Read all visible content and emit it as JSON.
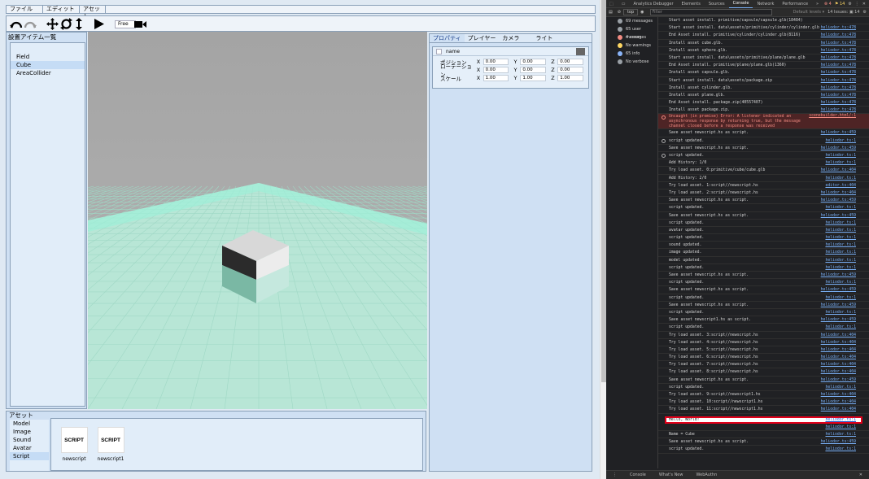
{
  "app": {
    "menu": [
      "ファイル",
      "エディット",
      "アセット"
    ],
    "toolbar": {
      "free_label": "Free"
    },
    "left_panel": {
      "title": "設置アイテム一覧",
      "items": [
        "Field",
        "Cube",
        "AreaCollider"
      ],
      "selected": 1
    },
    "right_panel": {
      "tabs": [
        "プロパティ",
        "プレイヤー",
        "カメラ",
        "ライト"
      ],
      "name_label": "name",
      "rows": [
        {
          "label": "ポジション",
          "x": "0.00",
          "y": "0.00",
          "z": "0.00"
        },
        {
          "label": "ローテーション",
          "x": "0.00",
          "y": "0.00",
          "z": "0.00"
        },
        {
          "label": "スケール",
          "x": "1.00",
          "y": "1.00",
          "z": "1.00"
        }
      ]
    },
    "bottom_panel": {
      "title": "アセット",
      "categories": [
        "Model",
        "Image",
        "Sound",
        "Avatar",
        "Script"
      ],
      "selected": 4,
      "assets": [
        {
          "thumb": "SCRIPT",
          "name": "newscript"
        },
        {
          "thumb": "SCRIPT",
          "name": "newscript1"
        }
      ]
    }
  },
  "devtools": {
    "tabs": [
      "Analytics Debugger",
      "Elements",
      "Sources",
      "Console",
      "Network",
      "Performance",
      "»"
    ],
    "active_tab": "Console",
    "issues_errors": "4",
    "issues_warnings": "14",
    "filter_context": "top",
    "filter_placeholder": "Filter",
    "levels": "Default levels ▾",
    "issues_count": "14 Issues: ▣ 14",
    "sidebar": [
      {
        "label": "69 messages",
        "color": "#9aa0a6"
      },
      {
        "label": "65 user messages",
        "color": "#9aa0a6"
      },
      {
        "label": "4 errors",
        "color": "#f28b82"
      },
      {
        "label": "No warnings",
        "color": "#fdd663"
      },
      {
        "label": "65 info",
        "color": "#8ab4f8"
      },
      {
        "label": "No verbose",
        "color": "#9aa0a6"
      }
    ],
    "logs": [
      {
        "text": "Start asset install. primitive/capsule/capsule.glb(18484)",
        "src": ""
      },
      {
        "text": "Start asset install. data\\assets/primitive/cylinder/cylinder.glb",
        "src": "heliodor.ts:478"
      },
      {
        "text": "End Asset install. primitive/cylinder/cylinder.glb(8116)",
        "src": "heliodor.ts:478"
      },
      {
        "text": "Install asset cube.glb.",
        "src": "heliodor.ts:478"
      },
      {
        "text": "Install asset sphere.glb.",
        "src": "heliodor.ts:478"
      },
      {
        "text": "Start asset install. data\\assets/primitive/plane/plane.glb",
        "src": "heliodor.ts:478"
      },
      {
        "text": "End Asset install. primitive/plane/plane.glb(1360)",
        "src": "heliodor.ts:478"
      },
      {
        "text": "Install asset capsule.glb.",
        "src": "heliodor.ts:478"
      },
      {
        "text": "Start asset install. data\\assets/package.zip",
        "src": "heliodor.ts:478"
      },
      {
        "text": "Install asset cylinder.glb.",
        "src": "heliodor.ts:478"
      },
      {
        "text": "Install asset plane.glb.",
        "src": "heliodor.ts:478"
      },
      {
        "text": "End Asset install. package.zip(40557407)",
        "src": "heliodor.ts:478"
      },
      {
        "text": "Install asset package.zip.",
        "src": "heliodor.ts:478"
      },
      {
        "text": "Uncaught (in promise) Error: A listener indicated an asynchronous response by returning true, but the message channel closed before a response was received",
        "src": "scenebuilder.html/:1",
        "err": true
      },
      {
        "text": "Save asset newscript.hs as script.",
        "src": "heliodor.ts:459"
      },
      {
        "text": "script updated.",
        "src": "heliodor.ts:1",
        "icon": true
      },
      {
        "text": "Save asset newscript.hs as script.",
        "src": "heliodor.ts:459"
      },
      {
        "text": "script updated.",
        "src": "heliodor.ts:1",
        "icon": true
      },
      {
        "text": "Add History: 1/0",
        "src": "heliodor.ts:1"
      },
      {
        "text": "Try load asset. 0:primitive/cube/cube.glb",
        "src": "heliodor.ts:404"
      },
      {
        "text": "Add History: 2/0",
        "src": "heliodor.ts:1"
      },
      {
        "text": "Try load asset. 1:script//newscript.hs",
        "src": "editor.ts:404"
      },
      {
        "text": "Try load asset. 2:script//newscript.hs",
        "src": "heliodor.ts:404"
      },
      {
        "text": "Save asset newscript.hs as script.",
        "src": "heliodor.ts:459"
      },
      {
        "text": "script updated.",
        "src": "heliodor.ts:1"
      },
      {
        "text": "Save asset newscript.hs as script.",
        "src": "heliodor.ts:459"
      },
      {
        "text": "script updated.",
        "src": "heliodor.ts:1"
      },
      {
        "text": "avatar updated.",
        "src": "heliodor.ts:1"
      },
      {
        "text": "script updated.",
        "src": "heliodor.ts:1"
      },
      {
        "text": "sound updated.",
        "src": "heliodor.ts:1"
      },
      {
        "text": "image updated.",
        "src": "heliodor.ts:1"
      },
      {
        "text": "model updated.",
        "src": "heliodor.ts:1"
      },
      {
        "text": "script updated.",
        "src": "heliodor.ts:1"
      },
      {
        "text": "Save asset newscript.hs as script.",
        "src": "heliodor.ts:459"
      },
      {
        "text": "script updated.",
        "src": "heliodor.ts:1"
      },
      {
        "text": "Save asset newscript.hs as script.",
        "src": "heliodor.ts:459"
      },
      {
        "text": "script updated.",
        "src": "heliodor.ts:1"
      },
      {
        "text": "Save asset newscript.hs as script.",
        "src": "heliodor.ts:459"
      },
      {
        "text": "script updated.",
        "src": "heliodor.ts:1"
      },
      {
        "text": "Save asset newscript1.hs as script.",
        "src": "heliodor.ts:459"
      },
      {
        "text": "script updated.",
        "src": "heliodor.ts:1"
      },
      {
        "text": "Try load asset. 3:script//newscript.hs",
        "src": "heliodor.ts:404"
      },
      {
        "text": "Try load asset. 4:script//newscript.hs",
        "src": "heliodor.ts:404"
      },
      {
        "text": "Try load asset. 5:script//newscript.hs",
        "src": "heliodor.ts:404"
      },
      {
        "text": "Try load asset. 6:script//newscript.hs",
        "src": "heliodor.ts:404"
      },
      {
        "text": "Try load asset. 7:script//newscript.hs",
        "src": "heliodor.ts:404"
      },
      {
        "text": "Try load asset. 8:script//newscript.hs",
        "src": "heliodor.ts:404"
      },
      {
        "text": "Save asset newscript.hs as script.",
        "src": "heliodor.ts:459"
      },
      {
        "text": "script updated.",
        "src": "heliodor.ts:1"
      },
      {
        "text": "Try load asset. 9:script//newscript1.hs",
        "src": "heliodor.ts:404"
      },
      {
        "text": "Try load asset. 10:script//newscript1.hs",
        "src": "heliodor.ts:404"
      },
      {
        "text": "Try load asset. 11:script//newscript1.hs",
        "src": "heliodor.ts:404"
      }
    ],
    "highlighted_log": {
      "text": "Hello, World!",
      "src": "heliodor.ts:1"
    },
    "tail_logs": [
      {
        "text": "",
        "src": "heliodor.ts:1"
      },
      {
        "text": "Name = Cube",
        "src": "heliodor.ts:1"
      },
      {
        "text": "Save asset newscript.hs as script.",
        "src": "heliodor.ts:459"
      },
      {
        "text": "script updated.",
        "src": "heliodor.ts:1"
      }
    ],
    "bottom_tabs": [
      "Console",
      "What's New",
      "WebAuthn"
    ]
  }
}
